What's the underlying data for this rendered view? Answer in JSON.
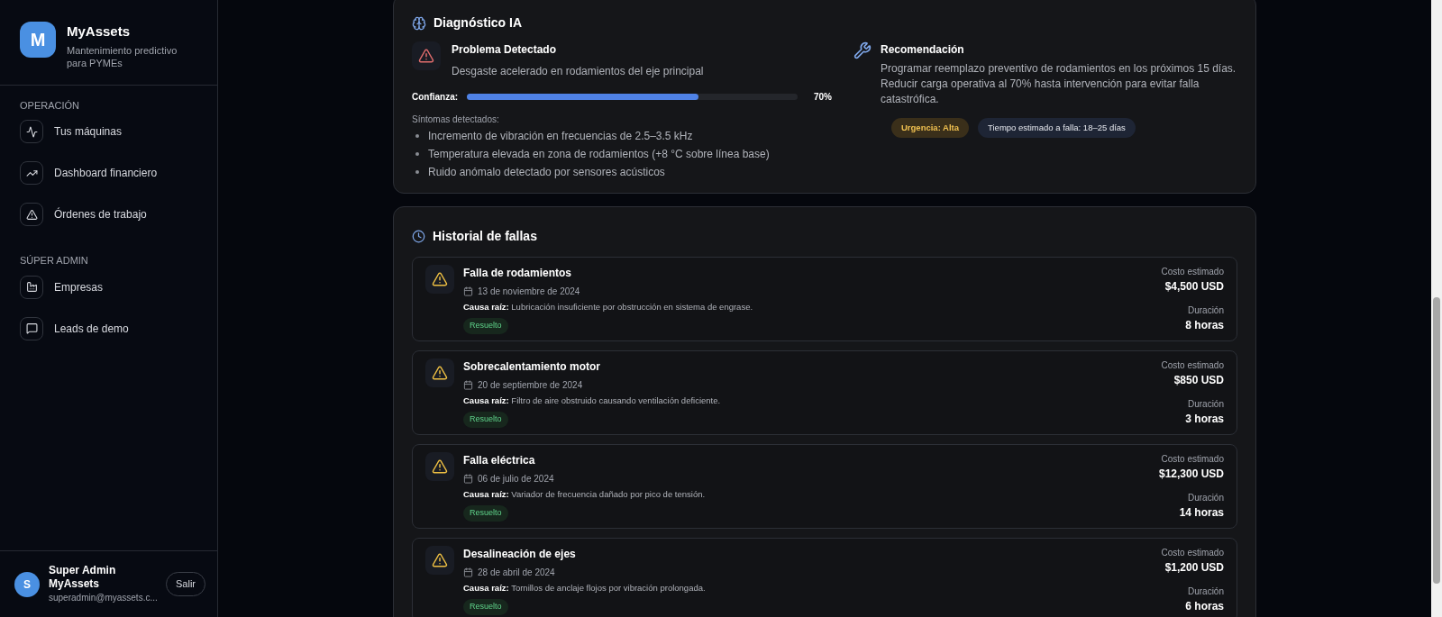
{
  "brand": {
    "logo": "M",
    "name": "MyAssets",
    "tagline": "Mantenimiento predictivo para PYMEs"
  },
  "nav_sections": [
    {
      "title": "OPERACIÓN",
      "items": [
        {
          "label": "Tus máquinas",
          "kind": "activity",
          "selected": false
        },
        {
          "label": "Dashboard financiero",
          "kind": "trend",
          "selected": false
        },
        {
          "label": "Órdenes de trabajo",
          "kind": "alert",
          "selected": false
        }
      ]
    },
    {
      "title": "SÚPER ADMIN",
      "items": [
        {
          "label": "Empresas",
          "kind": "factory",
          "selected": false
        },
        {
          "label": "Leads de demo",
          "kind": "message",
          "selected": false
        }
      ]
    }
  ],
  "user": {
    "avatar": "S",
    "name": "Super Admin MyAssets",
    "email": "superadmin@myassets.c...",
    "logout": "Salir"
  },
  "diagnosis": {
    "title": "Diagnóstico IA",
    "problem_title": "Problema Detectado",
    "problem": "Desgaste acelerado en rodamientos del eje principal",
    "confidence_label": "Confianza:",
    "confidence": {
      "level": 0.7
    },
    "confidence_reading": "70%",
    "symptoms_title": "Síntomas detectados:",
    "symptoms": [
      "Incremento de vibración en frecuencias de 2.5–3.5 kHz",
      "Temperatura elevada en zona de rodamientos (+8 °C sobre línea base)",
      "Ruido anómalo detectado por sensores acústicos"
    ],
    "recommendation_title": "Recomendación",
    "recommendation": "Programar reemplazo preventivo de rodamientos en los próximos 15 días. Reducir carga operativa al 70% hasta intervención para evitar falla catastrófica.",
    "tags": [
      {
        "label": "Urgencia: Alta",
        "color": "#3a2f1a"
      },
      {
        "label": "Tiempo estimado a falla: 18–25 días",
        "color": "#1e2535"
      }
    ]
  },
  "history": {
    "title": "Historial de fallas",
    "items": [
      {
        "title": "Falla de rodamientos",
        "date": "13 de noviembre de 2024",
        "cause": "**Causa raíz:** Lubricación insuficiente por obstrucción en sistema de engrase.",
        "status": "Resuelto",
        "cost_label": "Costo estimado",
        "cost": "$4,500 USD",
        "duration_label": "Duración",
        "duration": "8 horas"
      },
      {
        "title": "Sobrecalentamiento motor",
        "date": "20 de septiembre de 2024",
        "cause": "**Causa raíz:** Filtro de aire obstruido causando ventilación deficiente.",
        "status": "Resuelto",
        "cost_label": "Costo estimado",
        "cost": "$850 USD",
        "duration_label": "Duración",
        "duration": "3 horas"
      },
      {
        "title": "Falla eléctrica",
        "date": "06 de julio de 2024",
        "cause": "**Causa raíz:** Variador de frecuencia dañado por pico de tensión.",
        "status": "Resuelto",
        "cost_label": "Costo estimado",
        "cost": "$12,300 USD",
        "duration_label": "Duración",
        "duration": "14 horas"
      },
      {
        "title": "Desalineación de ejes",
        "date": "28 de abril de 2024",
        "cause": "**Causa raíz:** Tornillos de anclaje flojos por vibración prolongada.",
        "status": "Resuelto",
        "cost_label": "Costo estimado",
        "cost": "$1,200 USD",
        "duration_label": "Duración",
        "duration": "6 horas"
      }
    ]
  }
}
